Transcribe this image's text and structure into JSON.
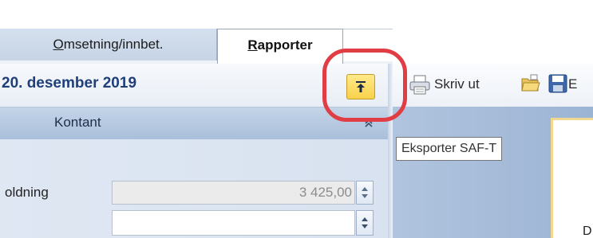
{
  "tabs": [
    {
      "label": "Omsetning/innbet.",
      "accel": "O",
      "rest": "msetning/innbet.",
      "active": false
    },
    {
      "label": "Rapporter",
      "accel": "R",
      "rest": "apporter",
      "active": true
    }
  ],
  "report": {
    "date_label": "20. desember 2019",
    "export_button_icon": "export-top-icon",
    "tooltip": "Eksporter SAF-T"
  },
  "group": {
    "label": "Kontant",
    "collapse_icon": "chevron-up-double-icon"
  },
  "form": {
    "field_label": "oldning",
    "field_value": "3 425,00",
    "field2_value": ""
  },
  "toolbar": {
    "print_label": "Skriv ut",
    "print_icon": "printer-icon",
    "open_icon": "folder-open-icon",
    "save_icon": "save-icon",
    "next_label_cut": "E"
  },
  "viewer": {
    "page_letter": "D"
  },
  "colors": {
    "date_text": "#1f3f7a",
    "highlight_ring": "#e03d45",
    "export_button": "#f9d24b",
    "group_header": "#aabfdb"
  }
}
